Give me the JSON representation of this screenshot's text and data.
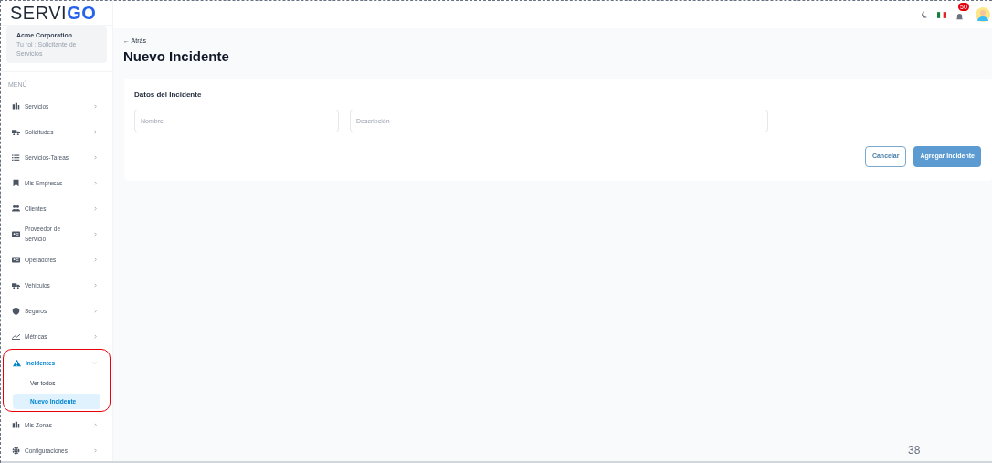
{
  "logo": {
    "text": "SERVI",
    "accent": "GO"
  },
  "organization": {
    "name": "Acme Corporation",
    "role": "Tu rol : Solicitante de Servicios"
  },
  "menu_label": "MENÚ",
  "nav": [
    {
      "label": "Servicios",
      "kind": "building",
      "expanded": false
    },
    {
      "label": "Solicitudes",
      "kind": "truck",
      "expanded": false
    },
    {
      "label": "Servicios-Tareas",
      "kind": "list",
      "expanded": false
    },
    {
      "label": "Mis Empresas",
      "kind": "bookmark",
      "expanded": false
    },
    {
      "label": "Clientes",
      "kind": "users",
      "expanded": false
    },
    {
      "label": "Proveedor de Servicio",
      "kind": "card",
      "expanded": false
    },
    {
      "label": "Operadores",
      "kind": "card",
      "expanded": false
    },
    {
      "label": "Vehiculos",
      "kind": "truck",
      "expanded": false
    },
    {
      "label": "Seguros",
      "kind": "shield",
      "expanded": false
    },
    {
      "label": "Métricas",
      "kind": "chart",
      "expanded": false
    },
    {
      "label": "Incidentes",
      "kind": "warning",
      "expanded": true,
      "highlighted": true,
      "children": [
        {
          "label": "Ver todos",
          "selected": false
        },
        {
          "label": "Nuevo Incidente",
          "selected": true
        }
      ]
    },
    {
      "label": "Mis Zonas",
      "kind": "building",
      "expanded": false
    },
    {
      "label": "Configuraciones",
      "kind": "gear",
      "expanded": false
    }
  ],
  "topbar": {
    "notification_count": "50"
  },
  "back_link": "← Atrás",
  "page_title": "Nuevo Incidente",
  "form": {
    "title": "Datos del Incidente",
    "fields": [
      {
        "placeholder": "Nombre"
      },
      {
        "placeholder": "Descripción"
      }
    ],
    "buttons": [
      {
        "label": "Cancelar",
        "kind": "secondary"
      },
      {
        "label": "Agregar Incidente",
        "kind": "primary"
      }
    ]
  },
  "page_number": "38"
}
